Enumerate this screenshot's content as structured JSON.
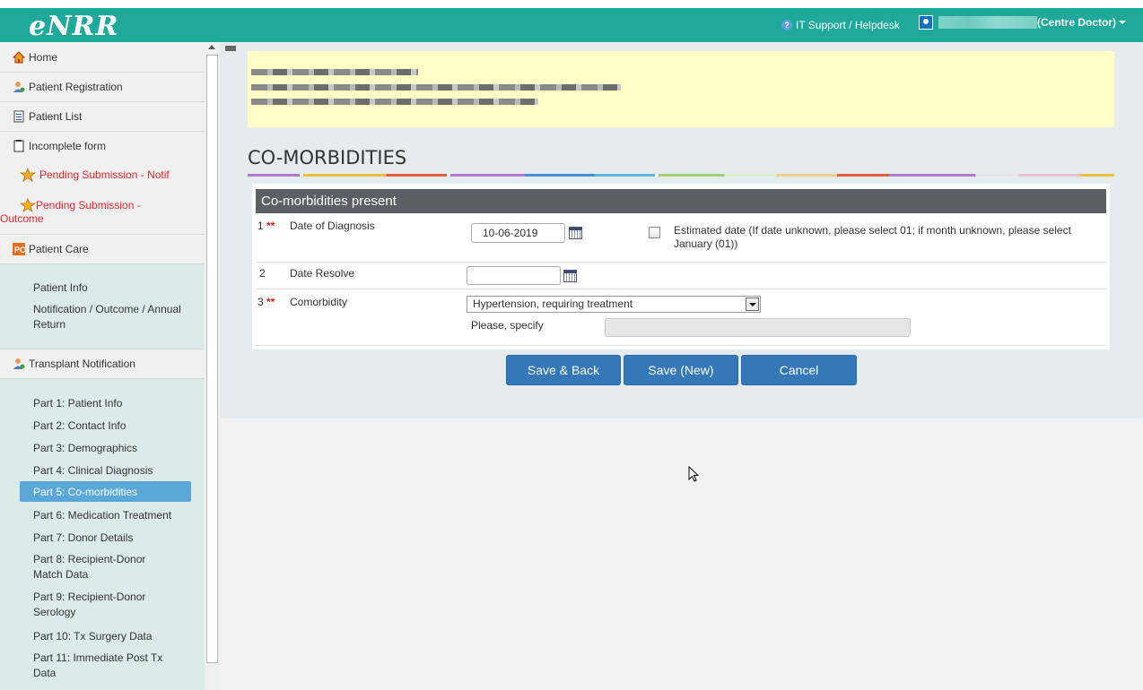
{
  "header": {
    "logo": "eNRR",
    "helpdesk": "IT Support / Helpdesk",
    "help_icon_char": "?",
    "user_role": "(Centre Doctor)"
  },
  "sidebar": {
    "items": [
      {
        "label": "Home",
        "icon": "home-icon"
      },
      {
        "label": "Patient Registration",
        "icon": "user-add-icon"
      },
      {
        "label": "Patient List",
        "icon": "clipboard-icon"
      },
      {
        "label": "Incomplete form",
        "icon": "form-icon"
      },
      {
        "label": "Pending Submission - Notif",
        "icon": "star-icon"
      },
      {
        "label": "Pending Submission - Outcome",
        "icon": "star-icon"
      },
      {
        "label": "Patient Care",
        "icon": "pc-icon"
      }
    ],
    "patient_care_sub": [
      "Patient Info",
      "Notification / Outcome / Annual Return"
    ],
    "transplant": {
      "label": "Transplant Notification",
      "icon": "user-add-icon"
    },
    "transplant_sub": [
      "Part 1: Patient Info",
      "Part 2: Contact Info",
      "Part 3: Demographics",
      "Part 4: Clinical Diagnosis",
      "Part 5: Co-morbidities",
      "Part 6: Medication Treatment",
      "Part 7: Donor Details",
      "Part 8: Recipient-Donor Match Data",
      "Part 9: Recipient-Donor Serology",
      "Part 10: Tx Surgery Data",
      "Part 11: Immediate Post Tx Data"
    ]
  },
  "main": {
    "title": "CO-MORBIDITIES",
    "panel_title": "Co-morbidities present",
    "rows": [
      {
        "num": "1",
        "required": "**",
        "label": "Date of Diagnosis",
        "value": "10-06-2019"
      },
      {
        "num": "2",
        "required": "",
        "label": "Date Resolve",
        "value": ""
      },
      {
        "num": "3",
        "required": "**",
        "label": "Comorbidity",
        "value": "Hypertension, requiring treatment"
      }
    ],
    "estimated_date_text": "Estimated date (If date unknown, please select 01; if month unknown, please select January (01))",
    "specify_label": "Please, specify",
    "specify_value": ""
  },
  "buttons": {
    "save_back": "Save & Back",
    "save_new": "Save (New)",
    "cancel": "Cancel"
  },
  "colors": {
    "header": "#1fa99a",
    "primary_button": "#3478b8",
    "active_nav": "#5aa8d8",
    "required": "#d32020",
    "pending": "#e8252d"
  }
}
